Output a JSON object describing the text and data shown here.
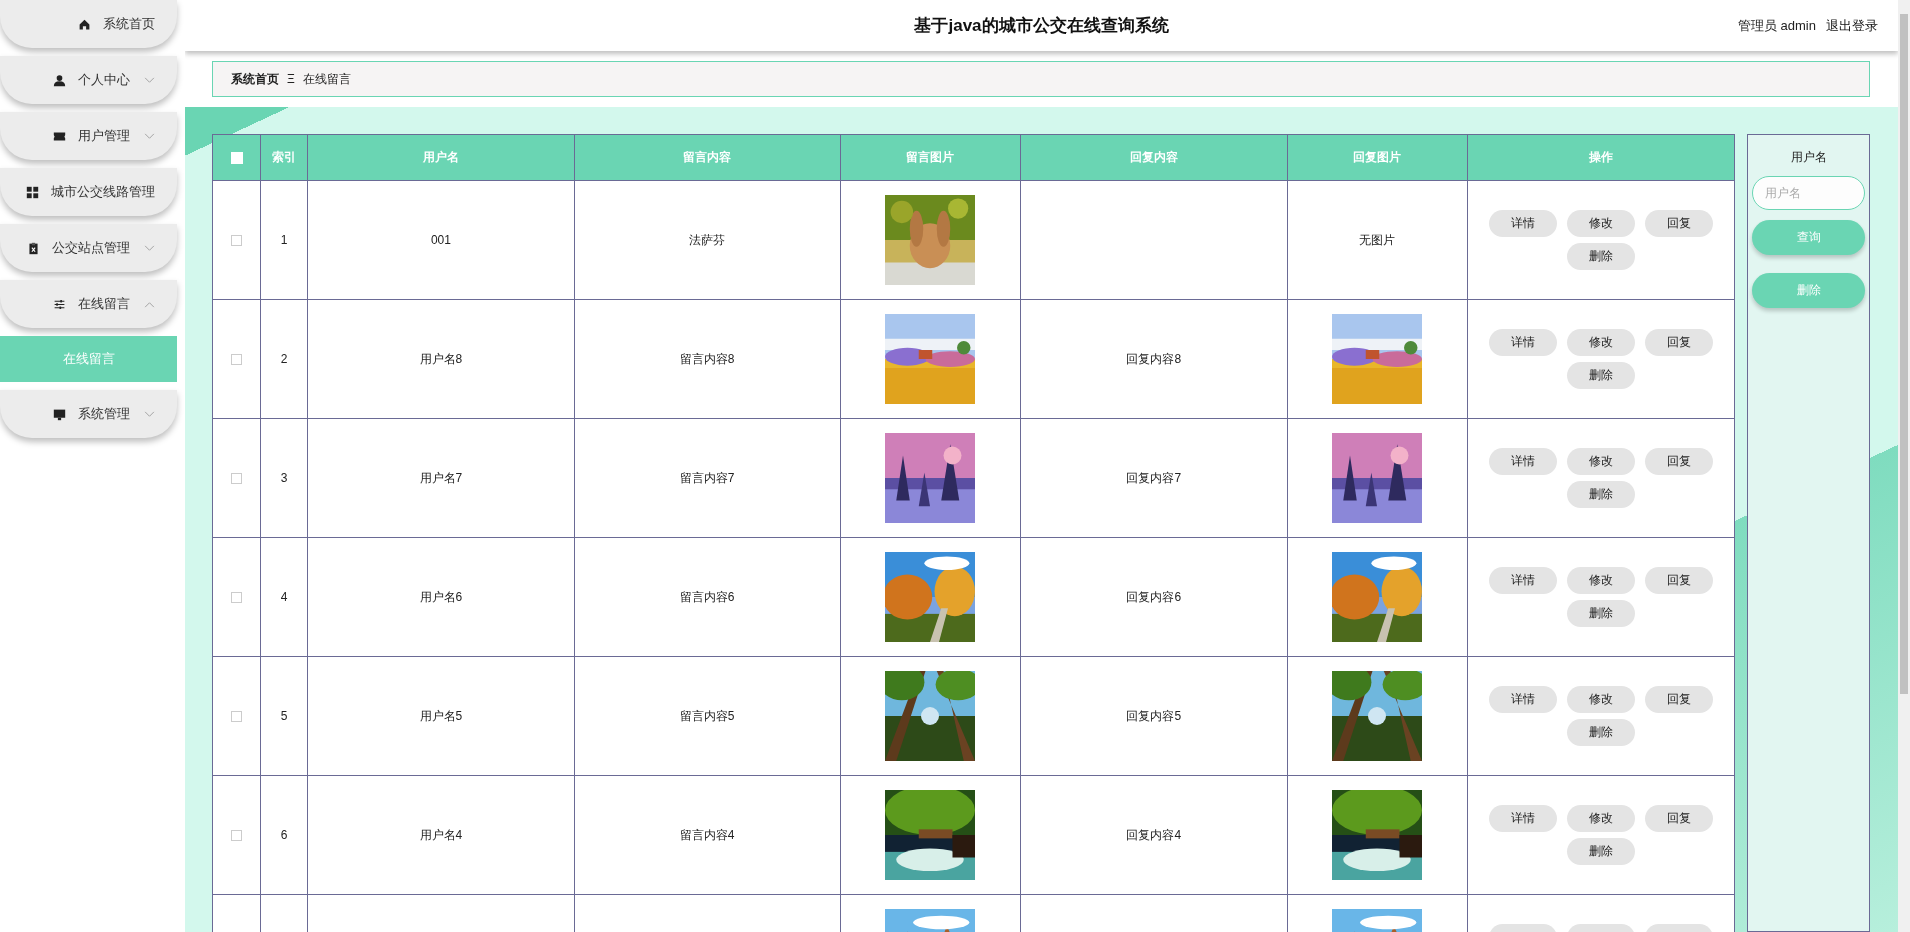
{
  "sidebar": {
    "items": [
      {
        "label": "系统首页"
      },
      {
        "label": "个人中心",
        "expanded": false
      },
      {
        "label": "用户管理",
        "expanded": false
      },
      {
        "label": "城市公交线路管理"
      },
      {
        "label": "公交站点管理",
        "expanded": false
      },
      {
        "label": "在线留言",
        "expanded": true,
        "children": [
          {
            "label": "在线留言",
            "selected": true
          }
        ]
      },
      {
        "label": "系统管理",
        "expanded": false
      }
    ]
  },
  "header": {
    "title": "基于java的城市公交在线查询系统",
    "user": "管理员 admin",
    "logout": "退出登录"
  },
  "breadcrumb": {
    "home": "系统首页",
    "separator": "Ξ",
    "current": "在线留言"
  },
  "table": {
    "select_all": {
      "checked": false
    },
    "columns": [
      "索引",
      "用户名",
      "留言内容",
      "留言图片",
      "回复内容",
      "回复图片",
      "操作"
    ],
    "rows": [
      {
        "checked": false,
        "index": "1",
        "username": "001",
        "content": "法萨芬",
        "reply_image_text": "无图片",
        "actions": [
          "详情",
          "修改",
          "回复",
          "删除"
        ]
      },
      {
        "checked": false,
        "index": "2",
        "username": "用户名8",
        "content": "留言内容8",
        "reply": "回复内容8",
        "actions": [
          "详情",
          "修改",
          "回复",
          "删除"
        ]
      },
      {
        "checked": false,
        "index": "3",
        "username": "用户名7",
        "content": "留言内容7",
        "reply": "回复内容7",
        "actions": [
          "详情",
          "修改",
          "回复",
          "删除"
        ]
      },
      {
        "checked": false,
        "index": "4",
        "username": "用户名6",
        "content": "留言内容6",
        "reply": "回复内容6",
        "actions": [
          "详情",
          "修改",
          "回复",
          "删除"
        ]
      },
      {
        "checked": false,
        "index": "5",
        "username": "用户名5",
        "content": "留言内容5",
        "reply": "回复内容5",
        "actions": [
          "详情",
          "修改",
          "回复",
          "删除"
        ]
      },
      {
        "checked": false,
        "index": "6",
        "username": "用户名4",
        "content": "留言内容4",
        "reply": "回复内容4",
        "actions": [
          "详情",
          "修改",
          "回复",
          "删除"
        ]
      },
      {
        "actions": [
          {
            "kind": "blank"
          },
          {
            "kind": "blank"
          },
          {
            "kind": "blank"
          }
        ]
      }
    ]
  },
  "search_panel": {
    "label": "用户名",
    "placeholder": "用户名",
    "search_button": "查询",
    "delete_button": "删除"
  }
}
